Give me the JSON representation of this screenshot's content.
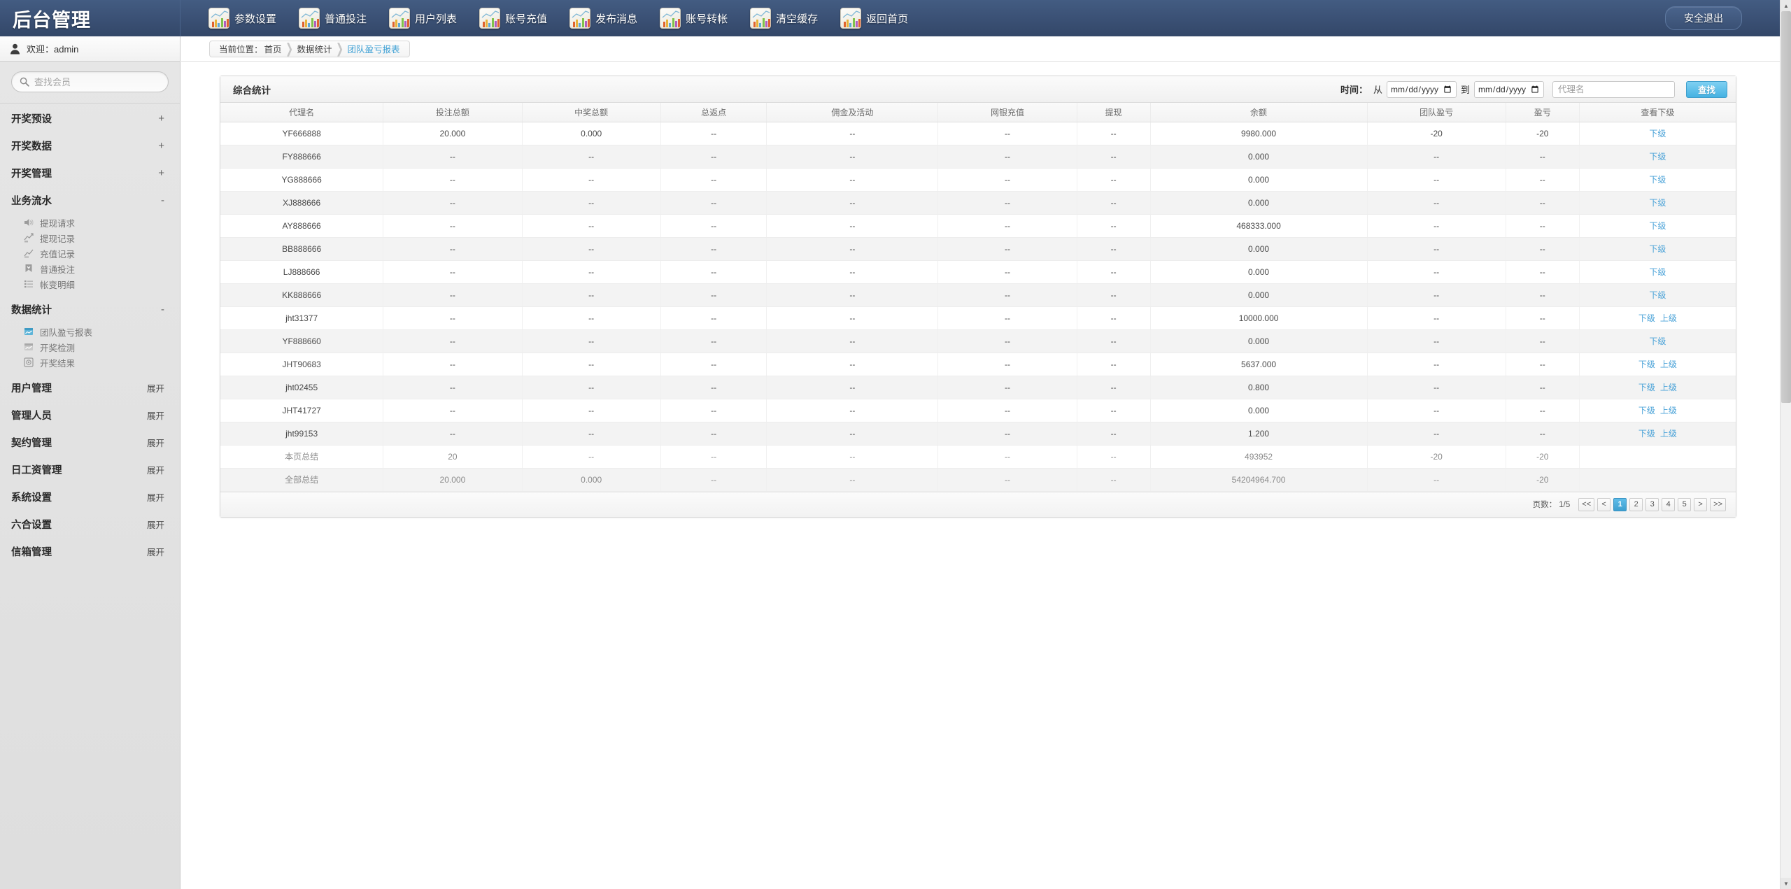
{
  "header": {
    "brand": "后台管理",
    "logout_label": "安全退出",
    "nav_items": [
      {
        "label": "参数设置",
        "icon": "chart-icon"
      },
      {
        "label": "普通投注",
        "icon": "chart-icon"
      },
      {
        "label": "用户列表",
        "icon": "chart-icon"
      },
      {
        "label": "账号充值",
        "icon": "chart-icon"
      },
      {
        "label": "发布消息",
        "icon": "chart-icon"
      },
      {
        "label": "账号转帐",
        "icon": "chart-icon"
      },
      {
        "label": "清空缓存",
        "icon": "chart-icon"
      },
      {
        "label": "返回首页",
        "icon": "chart-icon"
      }
    ]
  },
  "sidebar": {
    "welcome": "欢迎：admin",
    "search_placeholder": "查找会员",
    "search_value": "",
    "groups": [
      {
        "label": "开奖预设",
        "sign": "+",
        "expanded": false,
        "items": []
      },
      {
        "label": "开奖数据",
        "sign": "+",
        "expanded": false,
        "items": []
      },
      {
        "label": "开奖管理",
        "sign": "+",
        "expanded": false,
        "items": []
      },
      {
        "label": "业务流水",
        "sign": "-",
        "expanded": true,
        "items": [
          {
            "label": "提现请求",
            "icon": "speaker-icon"
          },
          {
            "label": "提现记录",
            "icon": "arrow-up-chart-icon"
          },
          {
            "label": "充值记录",
            "icon": "arrow-chart-icon"
          },
          {
            "label": "普通投注",
            "icon": "bookmark-icon"
          },
          {
            "label": "帐变明细",
            "icon": "list-icon"
          }
        ]
      },
      {
        "label": "数据统计",
        "sign": "-",
        "expanded": true,
        "items": [
          {
            "label": "团队盈亏报表",
            "icon": "report-chart-icon",
            "active": true
          },
          {
            "label": "开奖检测",
            "icon": "report-chart-icon"
          },
          {
            "label": "开奖结果",
            "icon": "target-icon"
          }
        ]
      },
      {
        "label": "用户管理",
        "sign": "展开",
        "expanded": false,
        "items": []
      },
      {
        "label": "管理人员",
        "sign": "展开",
        "expanded": false,
        "items": []
      },
      {
        "label": "契约管理",
        "sign": "展开",
        "expanded": false,
        "items": []
      },
      {
        "label": "日工资管理",
        "sign": "展开",
        "expanded": false,
        "items": []
      },
      {
        "label": "系统设置",
        "sign": "展开",
        "expanded": false,
        "items": []
      },
      {
        "label": "六合设置",
        "sign": "展开",
        "expanded": false,
        "items": []
      },
      {
        "label": "信箱管理",
        "sign": "展开",
        "expanded": false,
        "items": []
      }
    ]
  },
  "breadcrumb": {
    "prefix": "当前位置：",
    "home": "首页",
    "section": "数据统计",
    "current": "团队盈亏报表"
  },
  "panel": {
    "title": "综合统计",
    "filters": {
      "time_label": "时间：",
      "from_label": "从",
      "to_label": "到",
      "date_from": "",
      "date_to": "",
      "agent_placeholder": "代理名",
      "agent_value": "",
      "search_label": "查找"
    },
    "columns": [
      "代理名",
      "投注总额",
      "中奖总额",
      "总返点",
      "佣金及活动",
      "网银充值",
      "提现",
      "余额",
      "团队盈亏",
      "盈亏",
      "查看下级"
    ],
    "rows": [
      {
        "agent": "YF666888",
        "bet": "20.000",
        "win": "0.000",
        "rebate": "--",
        "commission": "--",
        "deposit": "--",
        "withdraw": "--",
        "balance": "9980.000",
        "team_pl": "-20",
        "pl": "-20",
        "links": [
          "下级"
        ]
      },
      {
        "agent": "FY888666",
        "bet": "--",
        "win": "--",
        "rebate": "--",
        "commission": "--",
        "deposit": "--",
        "withdraw": "--",
        "balance": "0.000",
        "team_pl": "--",
        "pl": "--",
        "links": [
          "下级"
        ]
      },
      {
        "agent": "YG888666",
        "bet": "--",
        "win": "--",
        "rebate": "--",
        "commission": "--",
        "deposit": "--",
        "withdraw": "--",
        "balance": "0.000",
        "team_pl": "--",
        "pl": "--",
        "links": [
          "下级"
        ]
      },
      {
        "agent": "XJ888666",
        "bet": "--",
        "win": "--",
        "rebate": "--",
        "commission": "--",
        "deposit": "--",
        "withdraw": "--",
        "balance": "0.000",
        "team_pl": "--",
        "pl": "--",
        "links": [
          "下级"
        ]
      },
      {
        "agent": "AY888666",
        "bet": "--",
        "win": "--",
        "rebate": "--",
        "commission": "--",
        "deposit": "--",
        "withdraw": "--",
        "balance": "468333.000",
        "team_pl": "--",
        "pl": "--",
        "links": [
          "下级"
        ]
      },
      {
        "agent": "BB888666",
        "bet": "--",
        "win": "--",
        "rebate": "--",
        "commission": "--",
        "deposit": "--",
        "withdraw": "--",
        "balance": "0.000",
        "team_pl": "--",
        "pl": "--",
        "links": [
          "下级"
        ]
      },
      {
        "agent": "LJ888666",
        "bet": "--",
        "win": "--",
        "rebate": "--",
        "commission": "--",
        "deposit": "--",
        "withdraw": "--",
        "balance": "0.000",
        "team_pl": "--",
        "pl": "--",
        "links": [
          "下级"
        ]
      },
      {
        "agent": "KK888666",
        "bet": "--",
        "win": "--",
        "rebate": "--",
        "commission": "--",
        "deposit": "--",
        "withdraw": "--",
        "balance": "0.000",
        "team_pl": "--",
        "pl": "--",
        "links": [
          "下级"
        ]
      },
      {
        "agent": "jht31377",
        "bet": "--",
        "win": "--",
        "rebate": "--",
        "commission": "--",
        "deposit": "--",
        "withdraw": "--",
        "balance": "10000.000",
        "team_pl": "--",
        "pl": "--",
        "links": [
          "下级",
          "上级"
        ]
      },
      {
        "agent": "YF888660",
        "bet": "--",
        "win": "--",
        "rebate": "--",
        "commission": "--",
        "deposit": "--",
        "withdraw": "--",
        "balance": "0.000",
        "team_pl": "--",
        "pl": "--",
        "links": [
          "下级"
        ]
      },
      {
        "agent": "JHT90683",
        "bet": "--",
        "win": "--",
        "rebate": "--",
        "commission": "--",
        "deposit": "--",
        "withdraw": "--",
        "balance": "5637.000",
        "team_pl": "--",
        "pl": "--",
        "links": [
          "下级",
          "上级"
        ]
      },
      {
        "agent": "jht02455",
        "bet": "--",
        "win": "--",
        "rebate": "--",
        "commission": "--",
        "deposit": "--",
        "withdraw": "--",
        "balance": "0.800",
        "team_pl": "--",
        "pl": "--",
        "links": [
          "下级",
          "上级"
        ]
      },
      {
        "agent": "JHT41727",
        "bet": "--",
        "win": "--",
        "rebate": "--",
        "commission": "--",
        "deposit": "--",
        "withdraw": "--",
        "balance": "0.000",
        "team_pl": "--",
        "pl": "--",
        "links": [
          "下级",
          "上级"
        ]
      },
      {
        "agent": "jht99153",
        "bet": "--",
        "win": "--",
        "rebate": "--",
        "commission": "--",
        "deposit": "--",
        "withdraw": "--",
        "balance": "1.200",
        "team_pl": "--",
        "pl": "--",
        "links": [
          "下级",
          "上级"
        ]
      }
    ],
    "summary_rows": [
      {
        "agent": "本页总结",
        "bet": "20",
        "win": "--",
        "rebate": "--",
        "commission": "--",
        "deposit": "--",
        "withdraw": "--",
        "balance": "493952",
        "team_pl": "-20",
        "pl": "-20",
        "links": []
      },
      {
        "agent": "全部总结",
        "bet": "20.000",
        "win": "0.000",
        "rebate": "--",
        "commission": "--",
        "deposit": "--",
        "withdraw": "--",
        "balance": "54204964.700",
        "team_pl": "--",
        "pl": "-20",
        "links": []
      }
    ],
    "pager": {
      "info": "页数： 1/5",
      "first": "<<",
      "prev": "<",
      "pages": [
        "1",
        "2",
        "3",
        "4",
        "5"
      ],
      "active_page": "1",
      "next": ">",
      "last": ">>"
    }
  }
}
